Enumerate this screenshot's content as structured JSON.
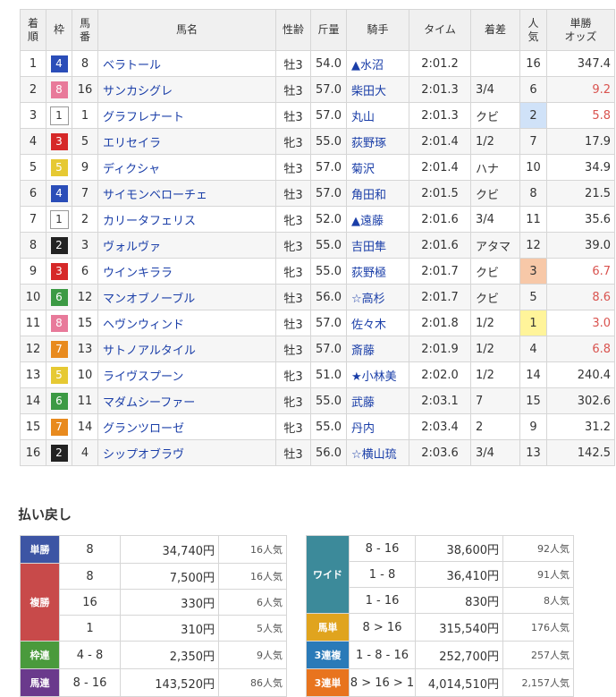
{
  "headers": {
    "finish": [
      "着",
      "順"
    ],
    "gate": "枠",
    "number": [
      "馬",
      "番"
    ],
    "horse": "馬名",
    "sexage": "性齢",
    "weight": "斤量",
    "jockey": "騎手",
    "time": "タイム",
    "margin": "着差",
    "pop": [
      "人",
      "気"
    ],
    "odds": [
      "単勝",
      "オッズ"
    ]
  },
  "gate_colors": {
    "1": {
      "bg": "#ffffff",
      "fg": "#333333"
    },
    "2": {
      "bg": "#222222",
      "fg": "#ffffff"
    },
    "3": {
      "bg": "#d62828",
      "fg": "#ffffff"
    },
    "4": {
      "bg": "#2a4db8",
      "fg": "#ffffff"
    },
    "5": {
      "bg": "#e6c933",
      "fg": "#ffffff"
    },
    "6": {
      "bg": "#3c9a44",
      "fg": "#ffffff"
    },
    "7": {
      "bg": "#e88a1e",
      "fg": "#ffffff"
    },
    "8": {
      "bg": "#e87a9a",
      "fg": "#ffffff"
    }
  },
  "results": [
    {
      "pos": "1",
      "gate": "4",
      "num": "8",
      "horse": "ベラトール",
      "sexage": "牡3",
      "weight": "54.0",
      "jockey": "▲水沼",
      "time": "2:01.2",
      "margin": "",
      "pop": "16",
      "odds": "347.4"
    },
    {
      "pos": "2",
      "gate": "8",
      "num": "16",
      "horse": "サンカシグレ",
      "sexage": "牡3",
      "weight": "57.0",
      "jockey": "柴田大",
      "time": "2:01.3",
      "margin": "3/4",
      "pop": "6",
      "odds": "9.2"
    },
    {
      "pos": "3",
      "gate": "1",
      "num": "1",
      "horse": "グラフレナート",
      "sexage": "牡3",
      "weight": "57.0",
      "jockey": "丸山",
      "time": "2:01.3",
      "margin": "クビ",
      "pop": "2",
      "odds": "5.8"
    },
    {
      "pos": "4",
      "gate": "3",
      "num": "5",
      "horse": "エリセイラ",
      "sexage": "牝3",
      "weight": "55.0",
      "jockey": "荻野琢",
      "time": "2:01.4",
      "margin": "1/2",
      "pop": "7",
      "odds": "17.9"
    },
    {
      "pos": "5",
      "gate": "5",
      "num": "9",
      "horse": "ディクシャ",
      "sexage": "牡3",
      "weight": "57.0",
      "jockey": "菊沢",
      "time": "2:01.4",
      "margin": "ハナ",
      "pop": "10",
      "odds": "34.9"
    },
    {
      "pos": "6",
      "gate": "4",
      "num": "7",
      "horse": "サイモンベローチェ",
      "sexage": "牡3",
      "weight": "57.0",
      "jockey": "角田和",
      "time": "2:01.5",
      "margin": "クビ",
      "pop": "8",
      "odds": "21.5"
    },
    {
      "pos": "7",
      "gate": "1",
      "num": "2",
      "horse": "カリータフェリス",
      "sexage": "牝3",
      "weight": "52.0",
      "jockey": "▲遠藤",
      "time": "2:01.6",
      "margin": "3/4",
      "pop": "11",
      "odds": "35.6"
    },
    {
      "pos": "8",
      "gate": "2",
      "num": "3",
      "horse": "ヴォルヴァ",
      "sexage": "牝3",
      "weight": "55.0",
      "jockey": "吉田隼",
      "time": "2:01.6",
      "margin": "アタマ",
      "pop": "12",
      "odds": "39.0"
    },
    {
      "pos": "9",
      "gate": "3",
      "num": "6",
      "horse": "ウインキララ",
      "sexage": "牝3",
      "weight": "55.0",
      "jockey": "荻野極",
      "time": "2:01.7",
      "margin": "クビ",
      "pop": "3",
      "odds": "6.7"
    },
    {
      "pos": "10",
      "gate": "6",
      "num": "12",
      "horse": "マンオブノーブル",
      "sexage": "牡3",
      "weight": "56.0",
      "jockey": "☆高杉",
      "time": "2:01.7",
      "margin": "クビ",
      "pop": "5",
      "odds": "8.6"
    },
    {
      "pos": "11",
      "gate": "8",
      "num": "15",
      "horse": "ヘヴンウィンド",
      "sexage": "牡3",
      "weight": "57.0",
      "jockey": "佐々木",
      "time": "2:01.8",
      "margin": "1/2",
      "pop": "1",
      "odds": "3.0"
    },
    {
      "pos": "12",
      "gate": "7",
      "num": "13",
      "horse": "サトノアルタイル",
      "sexage": "牡3",
      "weight": "57.0",
      "jockey": "斎藤",
      "time": "2:01.9",
      "margin": "1/2",
      "pop": "4",
      "odds": "6.8"
    },
    {
      "pos": "13",
      "gate": "5",
      "num": "10",
      "horse": "ライヴスプーン",
      "sexage": "牝3",
      "weight": "51.0",
      "jockey": "★小林美",
      "time": "2:02.0",
      "margin": "1/2",
      "pop": "14",
      "odds": "240.4"
    },
    {
      "pos": "14",
      "gate": "6",
      "num": "11",
      "horse": "マダムシーファー",
      "sexage": "牝3",
      "weight": "55.0",
      "jockey": "武藤",
      "time": "2:03.1",
      "margin": "7",
      "pop": "15",
      "odds": "302.6"
    },
    {
      "pos": "15",
      "gate": "7",
      "num": "14",
      "horse": "グランツローゼ",
      "sexage": "牝3",
      "weight": "55.0",
      "jockey": "丹内",
      "time": "2:03.4",
      "margin": "2",
      "pop": "9",
      "odds": "31.2"
    },
    {
      "pos": "16",
      "gate": "2",
      "num": "4",
      "horse": "シップオブラヴ",
      "sexage": "牡3",
      "weight": "56.0",
      "jockey": "☆横山琉",
      "time": "2:03.6",
      "margin": "3/4",
      "pop": "13",
      "odds": "142.5"
    }
  ],
  "payout_title": "払い戻し",
  "payout_left": [
    {
      "label": "単勝",
      "color": "#3d55a4",
      "rows": [
        {
          "comb": "8",
          "amount": "34,740円",
          "pop": "16人気"
        }
      ]
    },
    {
      "label": "複勝",
      "color": "#c84a4a",
      "rows": [
        {
          "comb": "8",
          "amount": "7,500円",
          "pop": "16人気"
        },
        {
          "comb": "16",
          "amount": "330円",
          "pop": "6人気"
        },
        {
          "comb": "1",
          "amount": "310円",
          "pop": "5人気"
        }
      ]
    },
    {
      "label": "枠連",
      "color": "#4a9a3c",
      "rows": [
        {
          "comb": "4 - 8",
          "amount": "2,350円",
          "pop": "9人気"
        }
      ]
    },
    {
      "label": "馬連",
      "color": "#6a3a8c",
      "rows": [
        {
          "comb": "8 - 16",
          "amount": "143,520円",
          "pop": "86人気"
        }
      ]
    }
  ],
  "payout_right": [
    {
      "label": "ワイド",
      "color": "#3c8a9a",
      "rows": [
        {
          "comb": "8 - 16",
          "amount": "38,600円",
          "pop": "92人気"
        },
        {
          "comb": "1 - 8",
          "amount": "36,410円",
          "pop": "91人気"
        },
        {
          "comb": "1 - 16",
          "amount": "830円",
          "pop": "8人気"
        }
      ]
    },
    {
      "label": "馬単",
      "color": "#e0a41e",
      "rows": [
        {
          "comb": "8 > 16",
          "amount": "315,540円",
          "pop": "176人気"
        }
      ]
    },
    {
      "label": "3連複",
      "color": "#2a7ab8",
      "rows": [
        {
          "comb": "1 - 8 - 16",
          "amount": "252,700円",
          "pop": "257人気"
        }
      ]
    },
    {
      "label": "3連単",
      "color": "#e8741e",
      "rows": [
        {
          "comb": "8 > 16 > 1",
          "amount": "4,014,510円",
          "pop": "2,157人気"
        }
      ]
    }
  ]
}
